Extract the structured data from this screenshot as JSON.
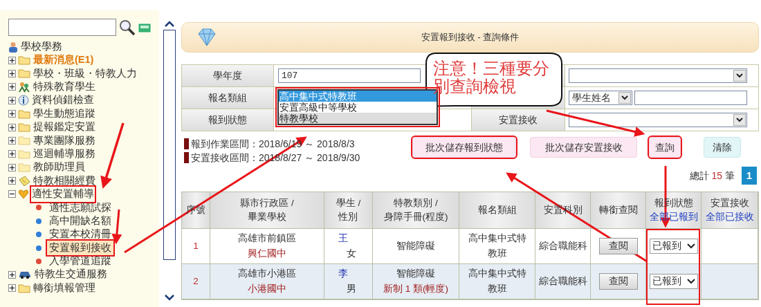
{
  "sidebar": {
    "items": [
      {
        "label": "學校學務",
        "kind": "person"
      },
      {
        "label": "最新消息(E1)",
        "kind": "folder",
        "expanded": false,
        "highlight": true
      },
      {
        "label": "學校・班級・特教人力",
        "kind": "folder",
        "expanded": false,
        "highlight": false
      },
      {
        "label": "特殊教育學生",
        "kind": "students",
        "expanded": false,
        "highlight": false
      },
      {
        "label": "資料偵錯檢查",
        "kind": "info",
        "expanded": false,
        "highlight": false
      },
      {
        "label": "學生動態追蹤",
        "kind": "folder",
        "expanded": false,
        "highlight": false
      },
      {
        "label": "提報鑑定安置",
        "kind": "folder",
        "expanded": false,
        "highlight": false
      },
      {
        "label": "專業團隊服務",
        "kind": "folder-light",
        "expanded": false,
        "highlight": false
      },
      {
        "label": "巡迴輔導服務",
        "kind": "folder-light",
        "expanded": false,
        "highlight": false
      },
      {
        "label": "教師助理員",
        "kind": "folder-light",
        "expanded": false,
        "highlight": false
      },
      {
        "label": "特教相關經費",
        "kind": "note",
        "expanded": false,
        "highlight": false
      },
      {
        "label": "適性安置輔導",
        "kind": "heart",
        "expanded": true,
        "highlight": false,
        "marked": true,
        "children": [
          {
            "label": "適性志願試探",
            "color": "#e04a3a",
            "selected": false,
            "marked": false
          },
          {
            "label": "高中開缺名額",
            "color": "#2f7fd8",
            "selected": false,
            "marked": false
          },
          {
            "label": "安置本校清冊",
            "color": "#2f7fd8",
            "selected": false,
            "marked": false
          },
          {
            "label": "安置報到接收",
            "color": "#2f7fd8",
            "selected": true,
            "marked": true
          },
          {
            "label": "入學管道追蹤",
            "color": "#e04a3a",
            "selected": false,
            "marked": false
          }
        ]
      },
      {
        "label": "特教生交通服務",
        "kind": "car",
        "expanded": false,
        "highlight": false
      },
      {
        "label": "轉銜填報管理",
        "kind": "folder",
        "expanded": false,
        "highlight": false
      }
    ]
  },
  "header": {
    "title": "安置報到接收 - 查詢條件"
  },
  "form": {
    "rows": [
      {
        "label": "學年度",
        "field": {
          "kind": "input",
          "value": "107"
        },
        "field2": {
          "kind": "select"
        }
      },
      {
        "label": "報名類組",
        "field": {
          "kind": "listbox",
          "marked": true,
          "options": [
            {
              "label": "高中集中式特教班",
              "selected": true
            },
            {
              "label": "安置高級中等學校",
              "selected": false
            },
            {
              "label": "特教學校",
              "selected": false
            }
          ]
        },
        "field2": {
          "kind": "select-input",
          "value": "學生姓名"
        }
      },
      {
        "label": "報到狀態",
        "field": {
          "kind": "none"
        },
        "label2": "安置接收",
        "field2": {
          "kind": "select"
        }
      }
    ]
  },
  "periods": [
    {
      "text": "報到作業區間：2018/6/19 ～ 2018/8/3"
    },
    {
      "text": "安置接收區間：2018/8/27 ～ 2018/9/30"
    }
  ],
  "buttons": [
    {
      "label": "批次儲存報到狀態",
      "kind": "pink",
      "marked": true
    },
    {
      "label": "批次儲存安置接收",
      "kind": "pink",
      "marked": false
    },
    {
      "label": "查詢",
      "kind": "pink",
      "marked": true
    },
    {
      "label": "清除",
      "kind": "cyan",
      "marked": false
    }
  ],
  "total": {
    "prefix": "總計",
    "count": "15",
    "suffix": "筆"
  },
  "pages": [
    {
      "label": "1",
      "selected": true
    }
  ],
  "callout": {
    "text": "注意！三種要分別查詢檢視"
  },
  "table": {
    "columns": [
      {
        "label": "序號"
      },
      {
        "label": "縣市行政區 /\n畢業學校"
      },
      {
        "label": "學生 /\n性別"
      },
      {
        "label": "特教類別 /\n身障手冊(程度)"
      },
      {
        "label": "報名類組"
      },
      {
        "label": "安置科別"
      },
      {
        "label": "轉銜查閱"
      },
      {
        "label": "報到狀態",
        "link": "全部已報到",
        "marked": true
      },
      {
        "label": "安置接收",
        "link": "全部已接收"
      }
    ],
    "rows": [
      {
        "no": "1",
        "district": "高雄市前鎮區",
        "school": "興仁國中",
        "student": "王",
        "gender": "女",
        "category": "智能障礙",
        "group": "高中集中式特教班",
        "dept": "綜合職能科",
        "view": "查閱",
        "status": "已報到"
      },
      {
        "no": "2",
        "district": "高雄市小港區",
        "school": "小港國中",
        "student": "李",
        "gender": "男",
        "category": "智能障礙",
        "manual": "新制 1 類(輕度)",
        "group": "高中集中式特教班",
        "dept": "綜合職能科",
        "view": "查閱",
        "status": "已報到"
      }
    ]
  }
}
